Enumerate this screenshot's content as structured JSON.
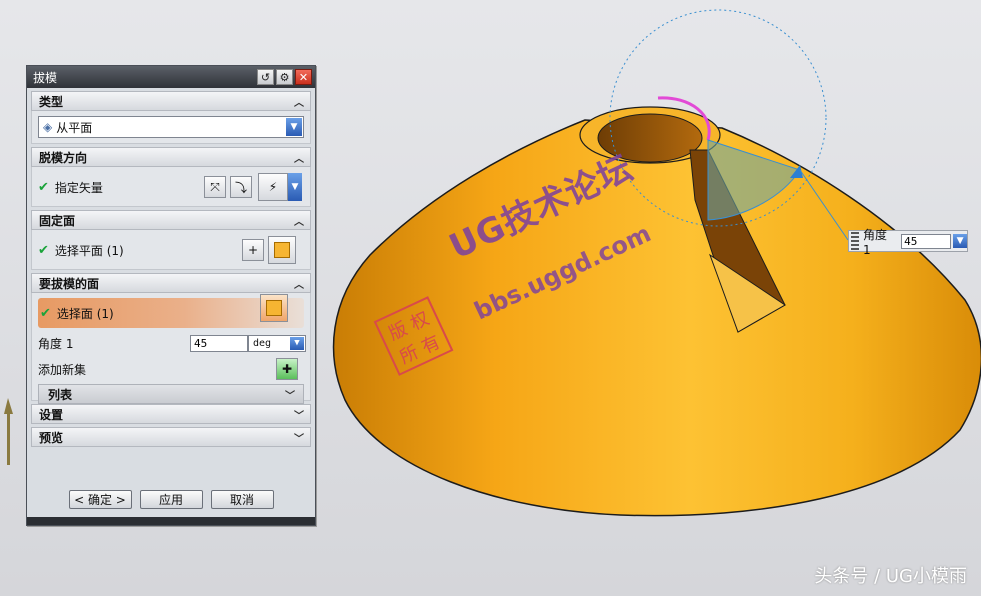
{
  "dialog": {
    "title": "拔模",
    "sections": {
      "type": {
        "header": "类型",
        "selected": "从平面"
      },
      "direction": {
        "header": "脱模方向",
        "label": "指定矢量"
      },
      "fixed_face": {
        "header": "固定面",
        "label": "选择平面 (1)"
      },
      "draft_faces": {
        "header": "要拔模的面",
        "label": "选择面 (1)",
        "angle_label": "角度 1",
        "angle_value": "45",
        "angle_unit": "deg",
        "add_set_label": "添加新集",
        "list_label": "列表"
      },
      "settings": {
        "header": "设置"
      },
      "preview": {
        "header": "预览"
      }
    },
    "buttons": {
      "ok": "< 确定 >",
      "apply": "应用",
      "cancel": "取消"
    }
  },
  "angle_widget": {
    "label": "角度 1",
    "value": "45"
  },
  "watermark": {
    "seal": [
      "版",
      "权",
      "所",
      "有"
    ],
    "title": "UG技术论坛",
    "url": "bbs.uggd.com"
  },
  "footer_credit": "头条号 / UG小模雨",
  "colors": {
    "model": "#f4a614",
    "selection": "#e8965e",
    "accent_blue": "#2a5bb3"
  }
}
